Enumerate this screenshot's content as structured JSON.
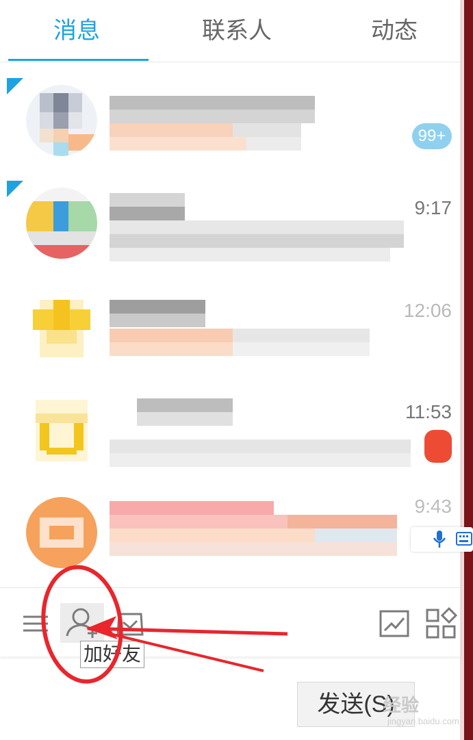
{
  "tabs": [
    {
      "label": "消息",
      "active": true
    },
    {
      "label": "联系人",
      "active": false
    },
    {
      "label": "动态",
      "active": false
    }
  ],
  "chats": [
    {
      "time": "",
      "badge": "99+",
      "unread_corner": true
    },
    {
      "time": "9:17",
      "badge": "",
      "unread_corner": true
    },
    {
      "time": "12:06",
      "badge": "",
      "unread_corner": false
    },
    {
      "time": "11:53",
      "badge": "",
      "unread_corner": false
    },
    {
      "time": "9:43",
      "badge": "",
      "unread_corner": false
    }
  ],
  "toolbar": {
    "tooltip": "加好友",
    "icons": [
      "menu-icon",
      "add-friend-icon",
      "app-box-icon",
      "trend-chart-icon",
      "apps-grid-icon"
    ]
  },
  "send_button": {
    "label": "发送(S)"
  },
  "watermark": {
    "text": "经验",
    "sub": "jingyan.baidu.com"
  },
  "colors": {
    "accent": "#1fa2e0",
    "annotation": "#e8262c",
    "badge_blue": "#8fd0ef",
    "badge_red": "#ee4b35"
  }
}
